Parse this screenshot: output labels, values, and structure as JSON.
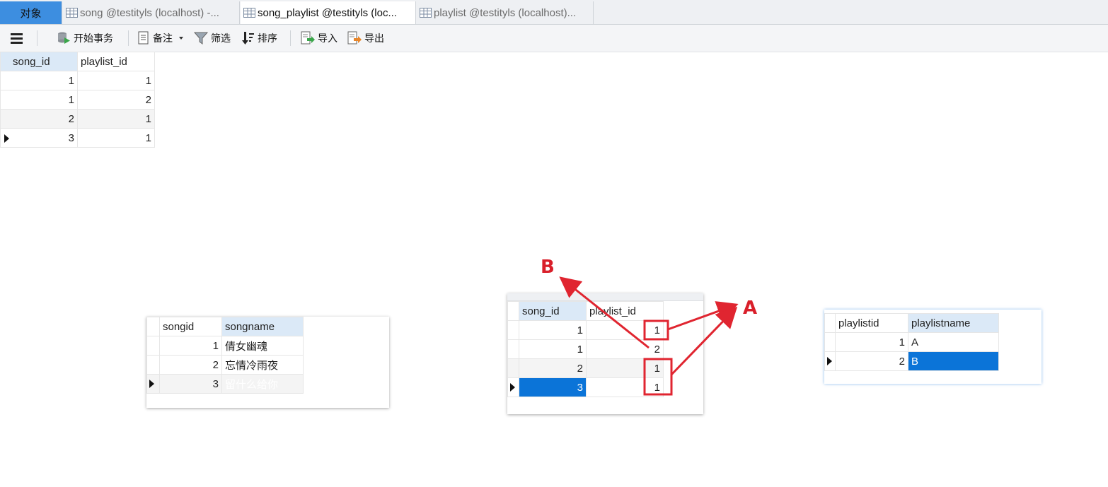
{
  "tabs": {
    "objects": "对象",
    "t1": "song @testityls (localhost) -...",
    "t2": "song_playlist @testityls (loc...",
    "t3": "playlist @testityls (localhost)..."
  },
  "toolbar": {
    "begin_transaction": "开始事务",
    "memo": "备注",
    "filter": "筛选",
    "sort": "排序",
    "import": "导入",
    "export": "导出"
  },
  "main_grid": {
    "columns": [
      "song_id",
      "playlist_id"
    ],
    "rows": [
      [
        "1",
        "1"
      ],
      [
        "1",
        "2"
      ],
      [
        "2",
        "1"
      ],
      [
        "3",
        "1"
      ]
    ]
  },
  "song_grid": {
    "columns": [
      "songid",
      "songname"
    ],
    "rows": [
      [
        "1",
        "倩女幽魂"
      ],
      [
        "2",
        "忘情冷雨夜"
      ],
      [
        "3",
        "留什么给你"
      ]
    ]
  },
  "sp_grid": {
    "columns": [
      "song_id",
      "playlist_id"
    ],
    "rows": [
      [
        "1",
        "1"
      ],
      [
        "1",
        "2"
      ],
      [
        "2",
        "1"
      ],
      [
        "3",
        "1"
      ]
    ]
  },
  "pl_grid": {
    "columns": [
      "playlistid",
      "playlistname"
    ],
    "rows": [
      [
        "1",
        "A"
      ],
      [
        "2",
        "B"
      ]
    ]
  },
  "annotations": {
    "a": "A",
    "b": "B",
    "color": "#d91f2a"
  }
}
